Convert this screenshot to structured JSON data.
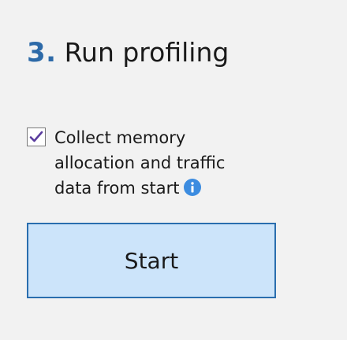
{
  "step": {
    "number": "3.",
    "title": "Run profiling"
  },
  "option": {
    "checked": true,
    "label": "Collect memory allocation and traffic data from start",
    "info_icon": "info-icon"
  },
  "start_button": {
    "label": "Start"
  },
  "colors": {
    "background": "#f2f2f2",
    "step_number": "#2d6aa8",
    "button_fill": "#cce4fa",
    "button_border": "#2a6eae",
    "check_mark": "#5a3c9e",
    "info_icon": "#3c8ce0"
  }
}
